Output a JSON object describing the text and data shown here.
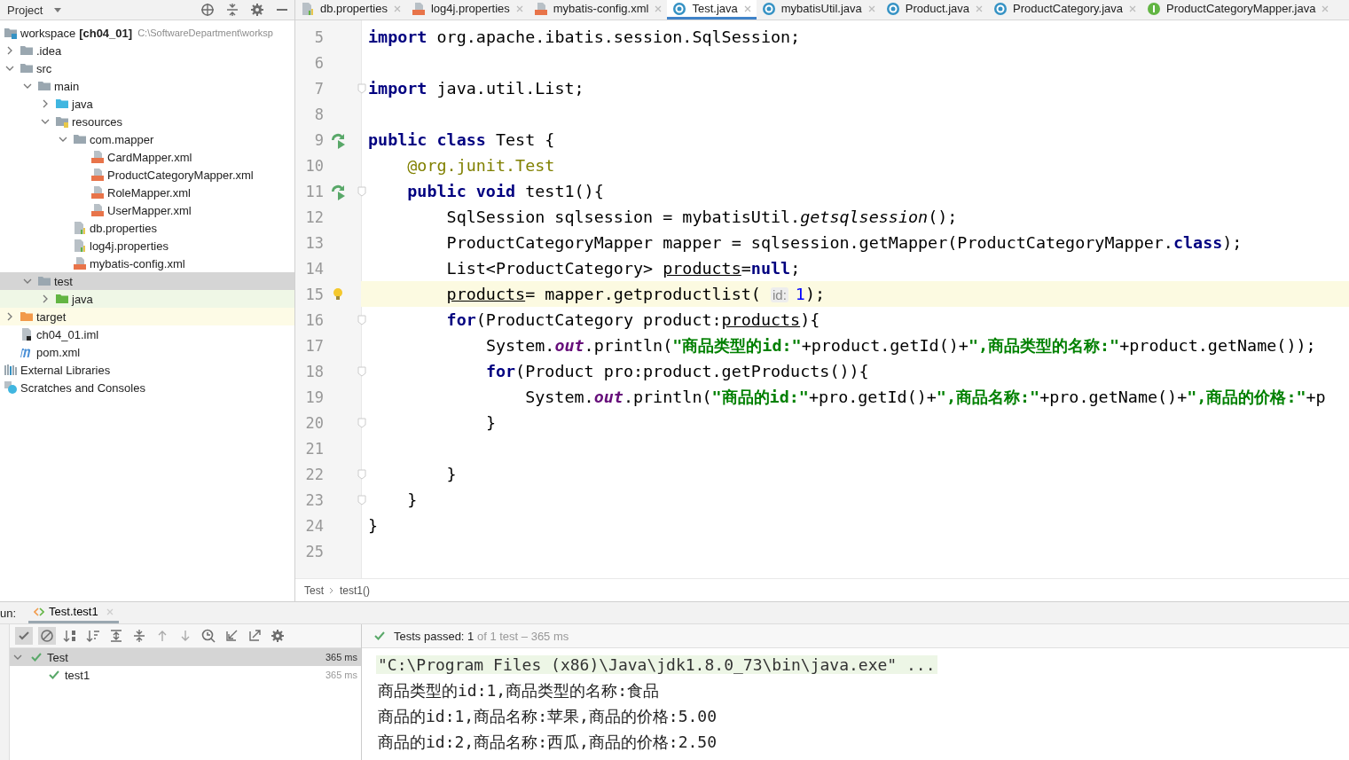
{
  "project_panel": {
    "title": "Project",
    "tree": [
      {
        "kind": "module",
        "name": "workspace",
        "module": "[ch04_01]",
        "path": "C:\\SoftwareDepartment\\worksp",
        "selected": false,
        "children": [
          {
            "kind": "folder",
            "name": ".idea",
            "selected": false,
            "expanded": false
          },
          {
            "kind": "folder",
            "name": "src",
            "selected": false,
            "expanded": true,
            "children": [
              {
                "kind": "folder",
                "name": "main",
                "selected": false,
                "expanded": true,
                "children": [
                  {
                    "kind": "source-folder",
                    "name": "java",
                    "selected": false,
                    "expanded": false
                  },
                  {
                    "kind": "resource-folder",
                    "name": "resources",
                    "selected": false,
                    "expanded": true,
                    "children": [
                      {
                        "kind": "folder",
                        "name": "com.mapper",
                        "selected": false,
                        "expanded": true,
                        "children": [
                          {
                            "kind": "xml",
                            "name": "CardMapper.xml",
                            "selected": false
                          },
                          {
                            "kind": "xml",
                            "name": "ProductCategoryMapper.xml",
                            "selected": false
                          },
                          {
                            "kind": "xml",
                            "name": "RoleMapper.xml",
                            "selected": false
                          },
                          {
                            "kind": "xml",
                            "name": "UserMapper.xml",
                            "selected": false
                          }
                        ]
                      },
                      {
                        "kind": "properties",
                        "name": "db.properties",
                        "selected": false
                      },
                      {
                        "kind": "properties",
                        "name": "log4j.properties",
                        "selected": false
                      },
                      {
                        "kind": "xml",
                        "name": "mybatis-config.xml",
                        "selected": false
                      }
                    ]
                  }
                ]
              },
              {
                "kind": "folder",
                "name": "test",
                "selected": true,
                "expanded": true,
                "children": [
                  {
                    "kind": "test-folder",
                    "name": "java",
                    "selected": false,
                    "expanded": false
                  }
                ]
              }
            ]
          },
          {
            "kind": "excluded-folder",
            "name": "target",
            "selected": false,
            "expanded": false
          },
          {
            "kind": "iml",
            "name": "ch04_01.iml",
            "selected": false
          },
          {
            "kind": "maven",
            "name": "pom.xml",
            "selected": false
          }
        ]
      },
      {
        "kind": "libraries",
        "name": "External Libraries",
        "selected": false
      },
      {
        "kind": "scratches",
        "name": "Scratches and Consoles",
        "selected": false
      }
    ]
  },
  "tabs": [
    {
      "kind": "properties",
      "label": "db.properties",
      "selected": false
    },
    {
      "kind": "xml",
      "label": "log4j.properties",
      "selected": false
    },
    {
      "kind": "xml",
      "label": "mybatis-config.xml",
      "selected": false
    },
    {
      "kind": "class",
      "label": "Test.java",
      "selected": true
    },
    {
      "kind": "class",
      "label": "mybatisUtil.java",
      "selected": false
    },
    {
      "kind": "class",
      "label": "Product.java",
      "selected": false
    },
    {
      "kind": "class",
      "label": "ProductCategory.java",
      "selected": false
    },
    {
      "kind": "interface",
      "label": "ProductCategoryMapper.java",
      "selected": false
    }
  ],
  "editor": {
    "lines": [
      {
        "number": "5",
        "run": false,
        "bulb": false,
        "fold": false,
        "current": false,
        "tokens": [
          {
            "kind": "keyword",
            "text": "import"
          },
          {
            "kind": "plain",
            "text": " org.apache.ibatis.session.SqlSession;"
          }
        ]
      },
      {
        "number": "6",
        "run": false,
        "bulb": false,
        "fold": false,
        "current": false
      },
      {
        "number": "7",
        "run": false,
        "bulb": false,
        "fold": true,
        "current": false,
        "tokens": [
          {
            "kind": "keyword",
            "text": "import"
          },
          {
            "kind": "plain",
            "text": " java.util.List;"
          }
        ]
      },
      {
        "number": "8",
        "run": false,
        "bulb": false,
        "fold": false,
        "current": false
      },
      {
        "number": "9",
        "run": true,
        "bulb": false,
        "fold": false,
        "current": false,
        "tokens": [
          {
            "kind": "keyword",
            "text": "public class"
          },
          {
            "kind": "plain",
            "text": " Test {"
          }
        ]
      },
      {
        "number": "10",
        "run": false,
        "bulb": false,
        "fold": false,
        "current": false,
        "tokens": [
          {
            "kind": "annotation",
            "text": "    @org.junit.Test"
          }
        ]
      },
      {
        "number": "11",
        "run": true,
        "bulb": false,
        "fold": true,
        "current": false,
        "tokens": [
          {
            "kind": "keyword",
            "text": "    public void"
          },
          {
            "kind": "plain",
            "text": " test1(){"
          }
        ]
      },
      {
        "number": "12",
        "run": false,
        "bulb": false,
        "fold": false,
        "current": false,
        "tokens": [
          {
            "kind": "plain",
            "text": "        SqlSession sqlsession = mybatisUtil."
          },
          {
            "kind": "static-method",
            "text": "getsqlsession"
          },
          {
            "kind": "plain",
            "text": "();"
          }
        ]
      },
      {
        "number": "13",
        "run": false,
        "bulb": false,
        "fold": false,
        "current": false,
        "tokens": [
          {
            "kind": "plain",
            "text": "        ProductCategoryMapper mapper = sqlsession.getMapper(ProductCategoryMapper."
          },
          {
            "kind": "keyword",
            "text": "class"
          },
          {
            "kind": "plain",
            "text": ");"
          }
        ]
      },
      {
        "number": "14",
        "run": false,
        "bulb": false,
        "fold": false,
        "current": false,
        "tokens": [
          {
            "kind": "plain",
            "text": "        List<ProductCategory> "
          },
          {
            "kind": "local",
            "text": "products"
          },
          {
            "kind": "plain",
            "text": "="
          },
          {
            "kind": "keyword",
            "text": "null"
          },
          {
            "kind": "plain",
            "text": ";"
          }
        ]
      },
      {
        "number": "15",
        "run": false,
        "bulb": true,
        "fold": false,
        "current": true,
        "tokens": [
          {
            "kind": "local",
            "text": "        products"
          },
          {
            "kind": "plain",
            "text": "= mapper.getproductlist( "
          },
          {
            "kind": "hint",
            "text": "id:"
          },
          {
            "kind": "number",
            "text": "1"
          },
          {
            "kind": "plain",
            "text": ");"
          }
        ]
      },
      {
        "number": "16",
        "run": false,
        "bulb": false,
        "fold": true,
        "current": false,
        "tokens": [
          {
            "kind": "keyword",
            "text": "        for"
          },
          {
            "kind": "plain",
            "text": "(ProductCategory product:"
          },
          {
            "kind": "local",
            "text": "products"
          },
          {
            "kind": "plain",
            "text": "){"
          }
        ]
      },
      {
        "number": "17",
        "run": false,
        "bulb": false,
        "fold": false,
        "current": false,
        "tokens": [
          {
            "kind": "plain",
            "text": "            System."
          },
          {
            "kind": "static-field",
            "text": "out"
          },
          {
            "kind": "plain",
            "text": ".println("
          },
          {
            "kind": "string",
            "text": "\"商品类型的id:\""
          },
          {
            "kind": "plain",
            "text": "+product.getId()+"
          },
          {
            "kind": "string",
            "text": "\",商品类型的名称:\""
          },
          {
            "kind": "plain",
            "text": "+product.getName());"
          }
        ]
      },
      {
        "number": "18",
        "run": false,
        "bulb": false,
        "fold": true,
        "current": false,
        "tokens": [
          {
            "kind": "keyword",
            "text": "            for"
          },
          {
            "kind": "plain",
            "text": "(Product pro:product.getProducts()){"
          }
        ]
      },
      {
        "number": "19",
        "run": false,
        "bulb": false,
        "fold": false,
        "current": false,
        "tokens": [
          {
            "kind": "plain",
            "text": "                System."
          },
          {
            "kind": "static-field",
            "text": "out"
          },
          {
            "kind": "plain",
            "text": ".println("
          },
          {
            "kind": "string",
            "text": "\"商品的id:\""
          },
          {
            "kind": "plain",
            "text": "+pro.getId()+"
          },
          {
            "kind": "string",
            "text": "\",商品名称:\""
          },
          {
            "kind": "plain",
            "text": "+pro.getName()+"
          },
          {
            "kind": "string",
            "text": "\",商品的价格:\""
          },
          {
            "kind": "plain",
            "text": "+p"
          }
        ]
      },
      {
        "number": "20",
        "run": false,
        "bulb": false,
        "fold": true,
        "current": false,
        "tokens": [
          {
            "kind": "plain",
            "text": "            }"
          }
        ]
      },
      {
        "number": "21",
        "run": false,
        "bulb": false,
        "fold": false,
        "current": false
      },
      {
        "number": "22",
        "run": false,
        "bulb": false,
        "fold": true,
        "current": false,
        "tokens": [
          {
            "kind": "plain",
            "text": "        }"
          }
        ]
      },
      {
        "number": "23",
        "run": false,
        "bulb": false,
        "fold": true,
        "current": false,
        "tokens": [
          {
            "kind": "plain",
            "text": "    }"
          }
        ]
      },
      {
        "number": "24",
        "run": false,
        "bulb": false,
        "fold": false,
        "current": false,
        "tokens": [
          {
            "kind": "plain",
            "text": "}"
          }
        ]
      },
      {
        "number": "25",
        "run": false,
        "bulb": false,
        "fold": false,
        "current": false
      }
    ],
    "breadcrumbs": [
      "Test",
      "test1()"
    ]
  },
  "run_panel": {
    "label": "un:",
    "tab": "Test.test1",
    "show_passed": true,
    "show_ignored": true,
    "status": {
      "prefix": "Tests passed: ",
      "count": "1",
      "rest": " of 1 test – 365 ms"
    },
    "tests": [
      {
        "name": "Test",
        "time": "365 ms",
        "selected": true,
        "children": [
          {
            "name": "test1",
            "time": "365 ms",
            "selected": false
          }
        ]
      }
    ],
    "console": [
      {
        "kind": "command",
        "text": "\"C:\\Program Files (x86)\\Java\\jdk1.8.0_73\\bin\\java.exe\" ..."
      },
      {
        "kind": "output",
        "text": "商品类型的id:1,商品类型的名称:食品"
      },
      {
        "kind": "output",
        "text": "商品的id:1,商品名称:苹果,商品的价格:5.00"
      },
      {
        "kind": "output",
        "text": "商品的id:2,商品名称:西瓜,商品的价格:2.50"
      }
    ]
  }
}
